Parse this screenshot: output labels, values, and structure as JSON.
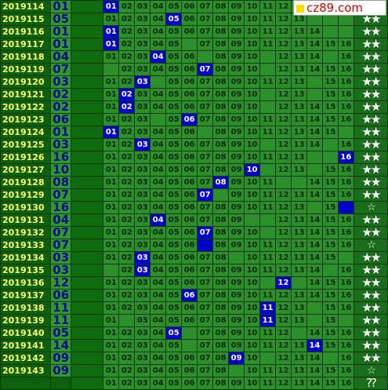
{
  "site_label": "cz89.com",
  "colors": {
    "hit": "#0000c8",
    "issue_text": "#ffff66",
    "draw_text": "#0a0a8a"
  },
  "rows": [
    {
      "issue": "2019114",
      "draw": "01",
      "hit": 1,
      "nums": [
        "01",
        "02",
        "03",
        "04",
        "05",
        "06",
        "07",
        "08",
        "09",
        "10",
        "11",
        "12",
        "",
        "",
        "",
        ""
      ],
      "stars": "★★"
    },
    {
      "issue": "2019115",
      "draw": "05",
      "hit": 5,
      "nums": [
        "01",
        "02",
        "03",
        "04",
        "05",
        "06",
        "07",
        "08",
        "09",
        "10",
        "11",
        "12",
        "13",
        "",
        "",
        ""
      ],
      "stars": "★★"
    },
    {
      "issue": "2019116",
      "draw": "01",
      "hit": 1,
      "nums": [
        "01",
        "02",
        "03",
        "04",
        "05",
        "06",
        "07",
        "08",
        "09",
        "10",
        "11",
        "12",
        "13",
        "14",
        "",
        ""
      ],
      "stars": "★★"
    },
    {
      "issue": "2019117",
      "draw": "01",
      "hit": 1,
      "nums": [
        "01",
        "02",
        "03",
        "04",
        "05",
        "",
        "07",
        "08",
        "09",
        "10",
        "11",
        "12",
        "13",
        "14",
        "15",
        "16"
      ],
      "stars": "★★"
    },
    {
      "issue": "2019118",
      "draw": "04",
      "hit": 4,
      "nums": [
        "01",
        "02",
        "03",
        "04",
        "05",
        "06",
        "",
        "08",
        "09",
        "10",
        "",
        "12",
        "13",
        "14",
        "",
        "16"
      ],
      "stars": "★★"
    },
    {
      "issue": "2019119",
      "draw": "07",
      "hit": 7,
      "nums": [
        "",
        "02",
        "03",
        "04",
        "05",
        "06",
        "07",
        "08",
        "09",
        "10",
        "",
        "12",
        "13",
        "14",
        "15",
        "16"
      ],
      "stars": "★★"
    },
    {
      "issue": "2019120",
      "draw": "03",
      "hit": 3,
      "nums": [
        "01",
        "02",
        "03",
        "",
        "05",
        "06",
        "07",
        "08",
        "09",
        "10",
        "11",
        "12",
        "13",
        "",
        "15",
        "16"
      ],
      "stars": "★★"
    },
    {
      "issue": "2019121",
      "draw": "02",
      "hit": 2,
      "nums": [
        "01",
        "02",
        "03",
        "04",
        "05",
        "06",
        "07",
        "08",
        "09",
        "10",
        "",
        "12",
        "13",
        "",
        "15",
        "16"
      ],
      "stars": "★★"
    },
    {
      "issue": "2019122",
      "draw": "02",
      "hit": 2,
      "nums": [
        "01",
        "02",
        "03",
        "04",
        "05",
        "06",
        "07",
        "08",
        "09",
        "10",
        "",
        "12",
        "13",
        "14",
        "15",
        "16"
      ],
      "stars": "★★"
    },
    {
      "issue": "2019123",
      "draw": "06",
      "hit": 6,
      "nums": [
        "01",
        "02",
        "03",
        "",
        "05",
        "06",
        "07",
        "08",
        "09",
        "10",
        "11",
        "12",
        "13",
        "14",
        "15",
        "16"
      ],
      "stars": "★★"
    },
    {
      "issue": "2019124",
      "draw": "01",
      "hit": 1,
      "nums": [
        "01",
        "02",
        "03",
        "04",
        "05",
        "06",
        "",
        "08",
        "09",
        "10",
        "11",
        "12",
        "13",
        "14",
        "15",
        ""
      ],
      "stars": "★★"
    },
    {
      "issue": "2019125",
      "draw": "03",
      "hit": 3,
      "nums": [
        "01",
        "02",
        "03",
        "04",
        "05",
        "06",
        "07",
        "08",
        "09",
        "10",
        "",
        "12",
        "13",
        "14",
        "",
        "16"
      ],
      "stars": "★★"
    },
    {
      "issue": "2019126",
      "draw": "16",
      "hit": 16,
      "nums": [
        "01",
        "02",
        "03",
        "04",
        "05",
        "06",
        "07",
        "08",
        "09",
        "10",
        "11",
        "12",
        "13",
        "",
        "",
        "16"
      ],
      "stars": "★★"
    },
    {
      "issue": "2019127",
      "draw": "10",
      "hit": 10,
      "nums": [
        "01",
        "02",
        "03",
        "04",
        "05",
        "06",
        "07",
        "08",
        "09",
        "10",
        "",
        "12",
        "13",
        "",
        "15",
        "16"
      ],
      "stars": "★★"
    },
    {
      "issue": "2019128",
      "draw": "08",
      "hit": 8,
      "nums": [
        "01",
        "02",
        "03",
        "04",
        "05",
        "06",
        "07",
        "08",
        "09",
        "10",
        "11",
        "",
        "",
        "14",
        "15",
        "16"
      ],
      "stars": "★★"
    },
    {
      "issue": "2019129",
      "draw": "07",
      "hit": 7,
      "nums": [
        "01",
        "02",
        "03",
        "04",
        "05",
        "06",
        "07",
        "",
        "09",
        "10",
        "11",
        "12",
        "13",
        "14",
        "15",
        "16"
      ],
      "stars": "★★"
    },
    {
      "issue": "2019130",
      "draw": "16",
      "hit": 16,
      "nums": [
        "01",
        "02",
        "03",
        "04",
        "05",
        "06",
        "07",
        "08",
        "09",
        "10",
        "11",
        "12",
        "13",
        "",
        "15",
        ""
      ],
      "stars": "☆"
    },
    {
      "issue": "2019131",
      "draw": "04",
      "hit": 4,
      "nums": [
        "01",
        "02",
        "03",
        "04",
        "05",
        "06",
        "07",
        "08",
        "09",
        "",
        "",
        "12",
        "13",
        "14",
        "15",
        "16"
      ],
      "stars": "★★"
    },
    {
      "issue": "2019132",
      "draw": "07",
      "hit": 7,
      "nums": [
        "01",
        "02",
        "03",
        "04",
        "05",
        "06",
        "07",
        "08",
        "09",
        "10",
        "",
        "12",
        "13",
        "14",
        "15",
        "16"
      ],
      "stars": "★★"
    },
    {
      "issue": "2019133",
      "draw": "07",
      "hit": 7,
      "nums": [
        "01",
        "02",
        "03",
        "04",
        "05",
        "06",
        "",
        "08",
        "09",
        "10",
        "11",
        "12",
        "13",
        "14",
        "15",
        "16"
      ],
      "stars": "☆"
    },
    {
      "issue": "2019134",
      "draw": "03",
      "hit": 3,
      "nums": [
        "01",
        "02",
        "03",
        "04",
        "05",
        "06",
        "07",
        "08",
        "",
        "10",
        "11",
        "12",
        "13",
        "14",
        "15",
        ""
      ],
      "stars": "★★"
    },
    {
      "issue": "2019135",
      "draw": "03",
      "hit": 3,
      "nums": [
        "",
        "02",
        "03",
        "04",
        "05",
        "06",
        "07",
        "08",
        "09",
        "10",
        "11",
        "12",
        "13",
        "14",
        "",
        "16"
      ],
      "stars": "★★"
    },
    {
      "issue": "2019136",
      "draw": "12",
      "hit": 12,
      "nums": [
        "01",
        "02",
        "03",
        "04",
        "05",
        "06",
        "07",
        "08",
        "09",
        "10",
        "",
        "12",
        "",
        "14",
        "15",
        "16"
      ],
      "stars": "★★"
    },
    {
      "issue": "2019137",
      "draw": "06",
      "hit": 6,
      "nums": [
        "01",
        "02",
        "03",
        "04",
        "05",
        "06",
        "07",
        "08",
        "09",
        "10",
        "11",
        "12",
        "13",
        "14",
        "15",
        "16"
      ],
      "stars": "★★"
    },
    {
      "issue": "2019138",
      "draw": "11",
      "hit": 11,
      "nums": [
        "01",
        "02",
        "03",
        "04",
        "05",
        "06",
        "07",
        "08",
        "09",
        "10",
        "11",
        "12",
        "13",
        "",
        "15",
        "16"
      ],
      "stars": "★★"
    },
    {
      "issue": "2019139",
      "draw": "11",
      "hit": 11,
      "nums": [
        "01",
        "",
        "03",
        "04",
        "05",
        "06",
        "07",
        "08",
        "09",
        "10",
        "11",
        "12",
        "13",
        "",
        "15",
        ""
      ],
      "stars": "★★"
    },
    {
      "issue": "2019140",
      "draw": "05",
      "hit": 5,
      "nums": [
        "01",
        "02",
        "03",
        "04",
        "05",
        "",
        "07",
        "08",
        "09",
        "10",
        "11",
        "12",
        "",
        "14",
        "15",
        "16"
      ],
      "stars": "★★"
    },
    {
      "issue": "2019141",
      "draw": "14",
      "hit": 14,
      "nums": [
        "01",
        "02",
        "03",
        "04",
        "05",
        "",
        "07",
        "08",
        "09",
        "10",
        "11",
        "12",
        "13",
        "14",
        "15",
        "16"
      ],
      "stars": "★★"
    },
    {
      "issue": "2019142",
      "draw": "09",
      "hit": 9,
      "nums": [
        "01",
        "02",
        "03",
        "04",
        "05",
        "06",
        "07",
        "08",
        "09",
        "10",
        "",
        "12",
        "13",
        "14",
        "",
        "16"
      ],
      "stars": "★★"
    },
    {
      "issue": "2019143",
      "draw": "09",
      "hit": null,
      "nums": [
        "01",
        "02",
        "03",
        "04",
        "05",
        "06",
        "07",
        "08",
        "",
        "10",
        "11",
        "12",
        "13",
        "14",
        "15",
        "16"
      ],
      "stars": "☆"
    },
    {
      "issue": "",
      "draw": "",
      "hit": null,
      "nums": [
        "01",
        "02",
        "03",
        "04",
        "05",
        "06",
        "07",
        "08",
        "09",
        "10",
        "11",
        "12",
        "13",
        "14",
        "15",
        "16"
      ],
      "stars": "??"
    }
  ]
}
